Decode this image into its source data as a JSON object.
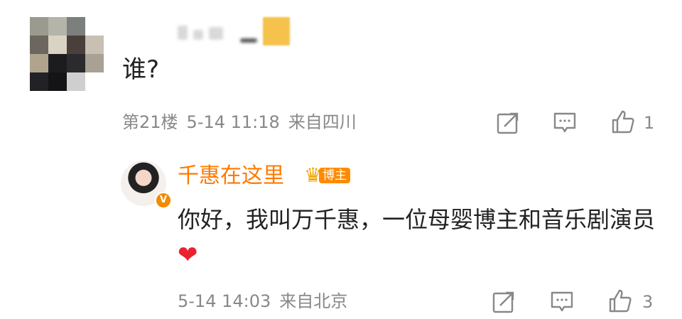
{
  "comment": {
    "text": "谁?",
    "floor": "第21楼",
    "time": "5-14 11:18",
    "location": "来自四川",
    "like_count": "1"
  },
  "reply": {
    "username": "千惠在这里",
    "badge_label": "博主",
    "text": "你好，我叫万千惠，一位母婴博主和音乐剧演员",
    "heart_glyph": "❤",
    "time": "5-14 14:03",
    "location": "来自北京",
    "like_count": "3"
  },
  "colors": {
    "username_orange": "#ff7a00",
    "meta_gray": "#888888",
    "heart_red": "#e8222f"
  },
  "icons": {
    "share": "share-icon",
    "comment": "comment-icon",
    "like": "thumbs-up-icon",
    "crown": "crown-icon"
  }
}
